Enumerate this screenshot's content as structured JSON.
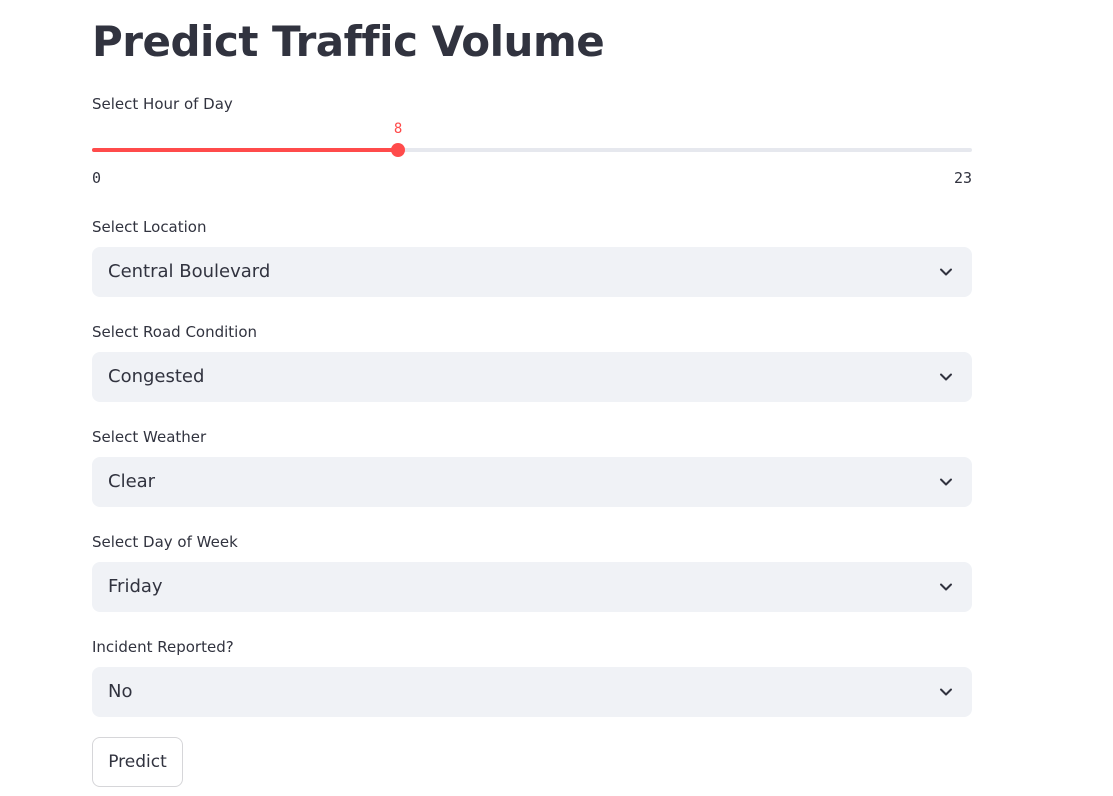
{
  "page": {
    "title": "Predict Traffic Volume"
  },
  "hour_slider": {
    "label": "Select Hour of Day",
    "value": 8,
    "min": 0,
    "max": 23,
    "accent_color": "#ff4b4b"
  },
  "location": {
    "label": "Select Location",
    "value": "Central Boulevard"
  },
  "road_condition": {
    "label": "Select Road Condition",
    "value": "Congested"
  },
  "weather": {
    "label": "Select Weather",
    "value": "Clear"
  },
  "day_of_week": {
    "label": "Select Day of Week",
    "value": "Friday"
  },
  "incident": {
    "label": "Incident Reported?",
    "value": "No"
  },
  "actions": {
    "predict_label": "Predict"
  },
  "icons": {
    "select_caret": "chevron-down-icon"
  }
}
